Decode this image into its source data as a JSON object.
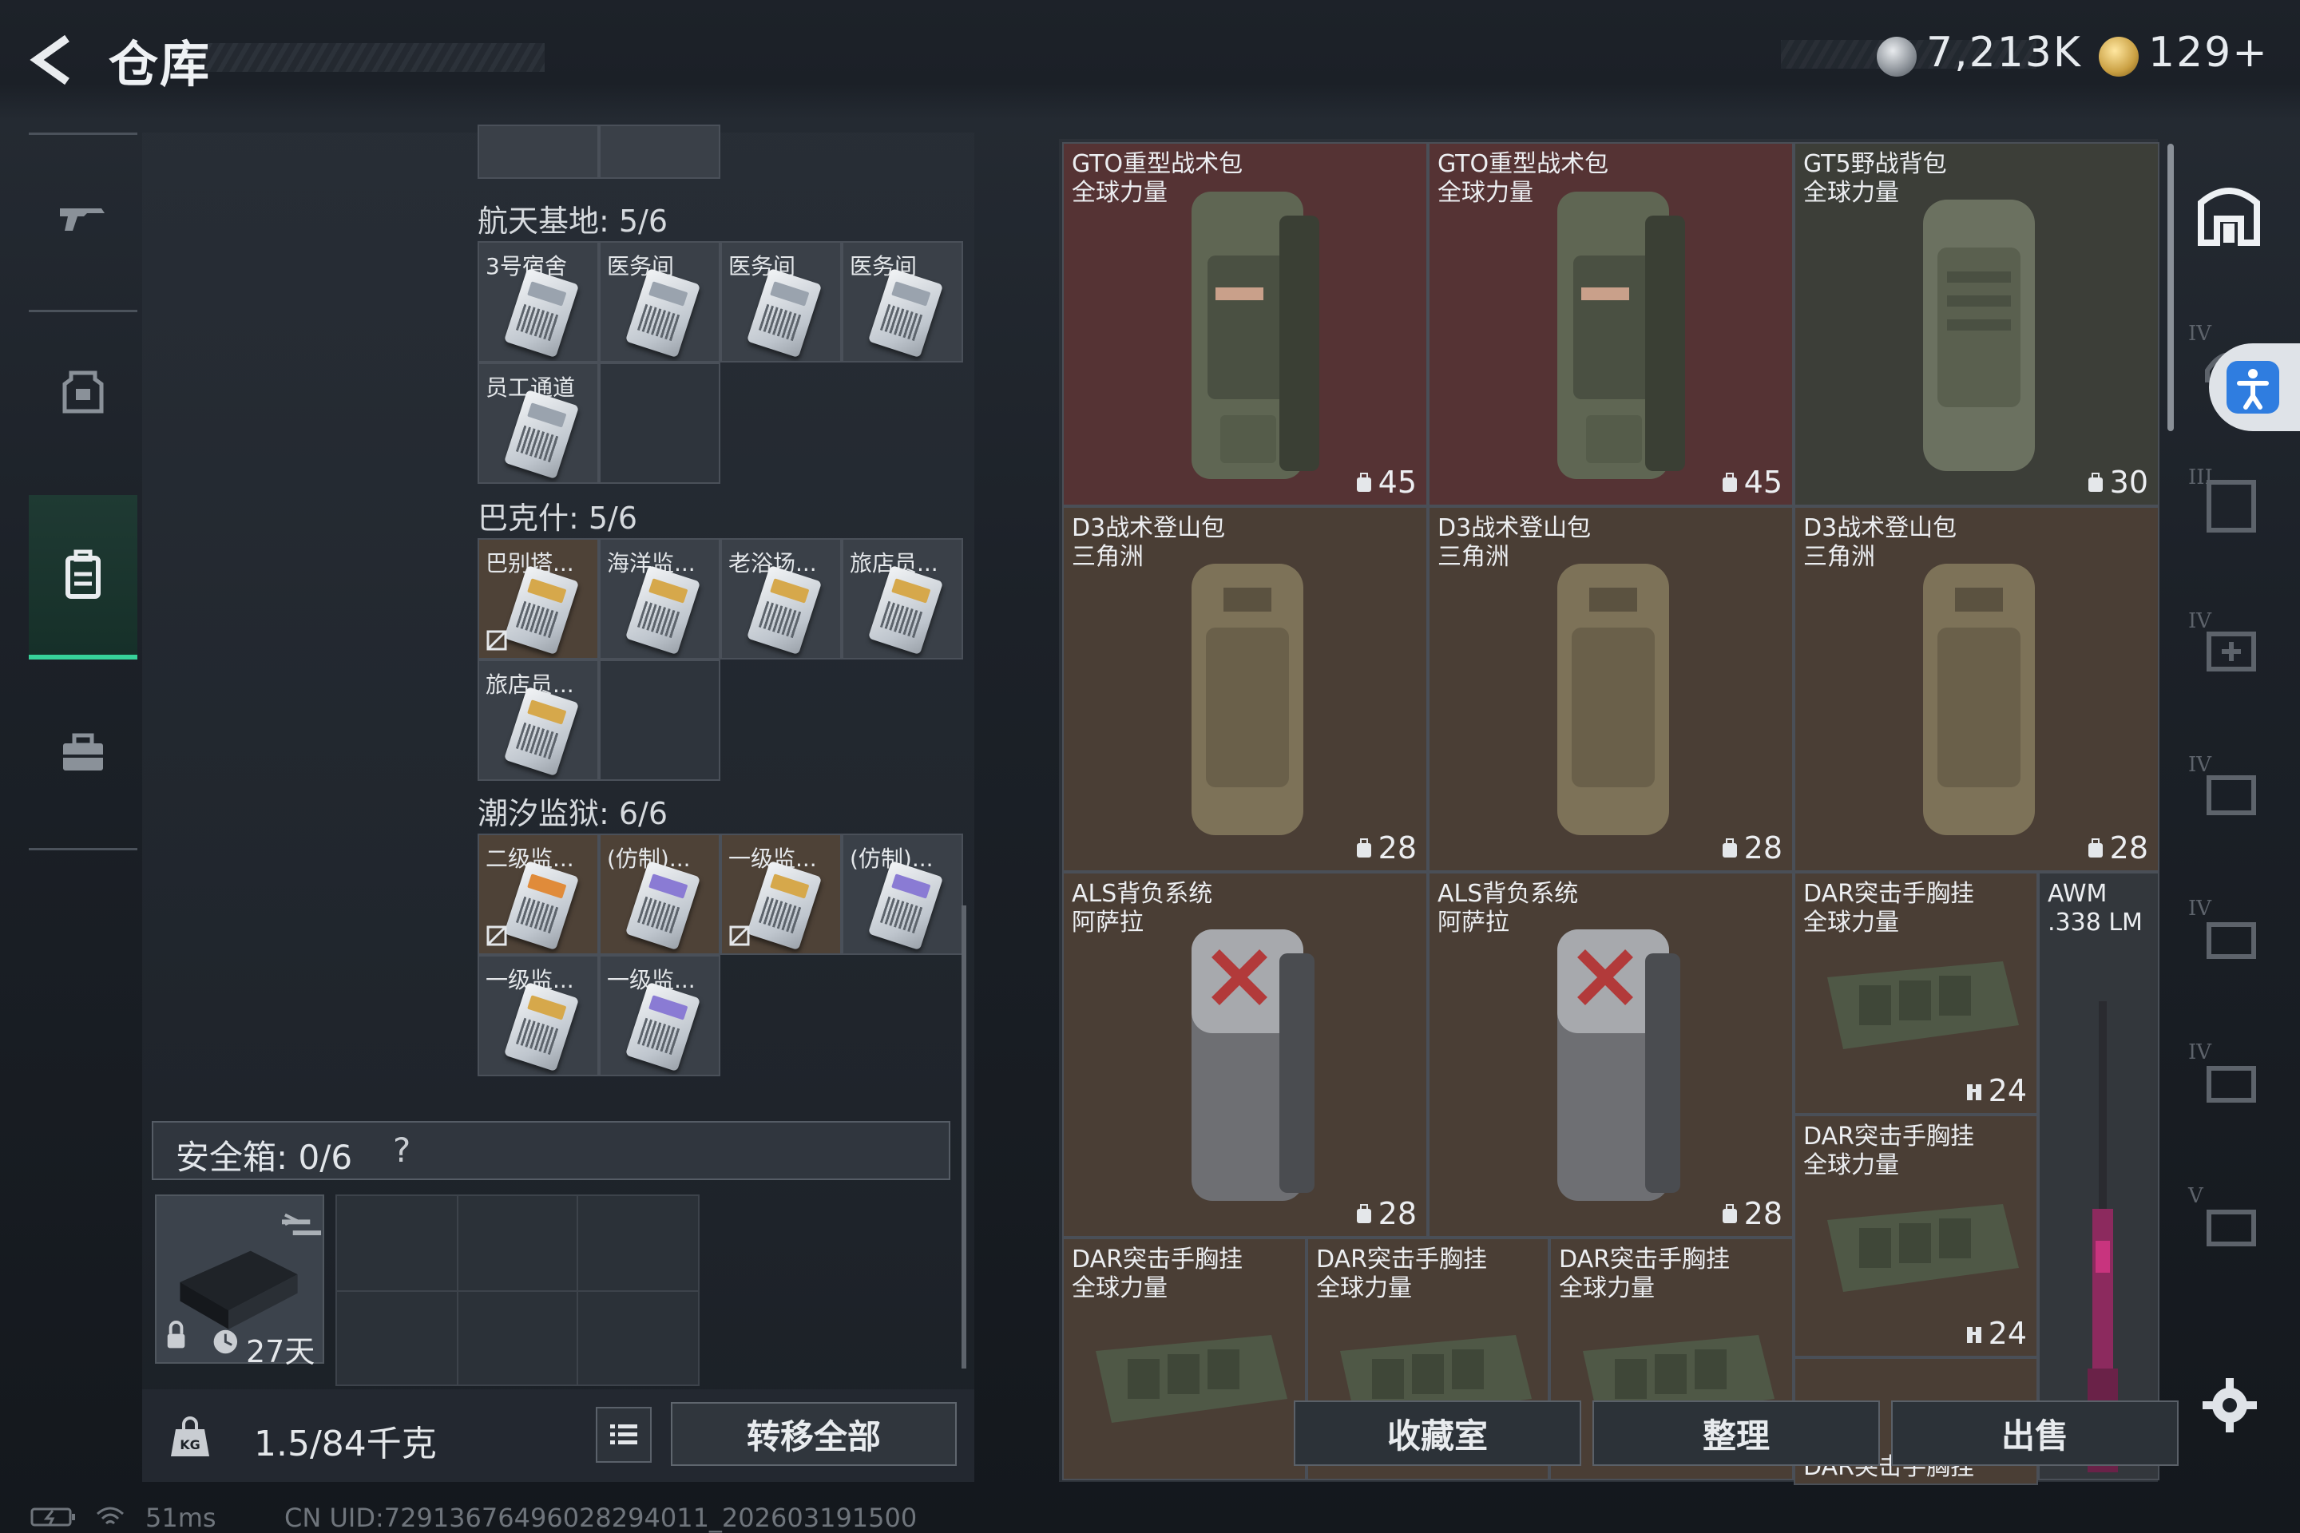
{
  "header": {
    "title": "仓库",
    "silver_value": "7,213K",
    "gold_value": "129+"
  },
  "nav": {
    "items": [
      {
        "name": "weapons",
        "icon": "gun-icon"
      },
      {
        "name": "gear",
        "icon": "armor-icon"
      },
      {
        "name": "backpack",
        "icon": "backpack-icon",
        "active": true
      },
      {
        "name": "items",
        "icon": "toolbox-icon"
      }
    ]
  },
  "keys": {
    "sections": [
      {
        "title": "航天基地: 5/6",
        "slots": [
          "3号宿舍",
          "医务间",
          "医务间",
          "医务间",
          "员工通道",
          ""
        ]
      },
      {
        "title": "巴克什: 5/6",
        "slots": [
          "巴别塔...",
          "海洋监...",
          "老浴场...",
          "旅店员...",
          "旅店员...",
          ""
        ]
      },
      {
        "title": "潮汐监狱: 6/6",
        "slots": [
          "二级监...",
          "(仿制)...",
          "一级监...",
          "(仿制)...",
          "一级监...",
          "一级监..."
        ]
      }
    ]
  },
  "safebox": {
    "label": "安全箱: 0/6",
    "help": "?",
    "duration": "27天"
  },
  "weight": {
    "text": "1.5/84千克"
  },
  "transfer_all": "转移全部",
  "warehouse": {
    "items": [
      {
        "name": "GTO重型战术包\n全球力量",
        "capacity": "45"
      },
      {
        "name": "GTO重型战术包\n全球力量",
        "capacity": "45"
      },
      {
        "name": "GT5野战背包\n全球力量",
        "capacity": "30"
      },
      {
        "name": "D3战术登山包\n三角洲",
        "capacity": "28"
      },
      {
        "name": "D3战术登山包\n三角洲",
        "capacity": "28"
      },
      {
        "name": "D3战术登山包\n三角洲",
        "capacity": "28"
      },
      {
        "name": "ALS背负系统\n阿萨拉",
        "capacity": "28"
      },
      {
        "name": "ALS背负系统\n阿萨拉",
        "capacity": "28"
      },
      {
        "name": "DAR突击手胸挂\n全球力量",
        "capacity": "24"
      },
      {
        "name": "DAR突击手胸挂\n全球力量",
        "capacity": "24"
      },
      {
        "name": "AWM\n.338 LM",
        "capacity": ""
      },
      {
        "name": "DAR突击手胸挂\n全球力量",
        "capacity": ""
      },
      {
        "name": "DAR突击手胸挂\n全球力量",
        "capacity": ""
      },
      {
        "name": "DAR突击手胸挂\n全球力量",
        "capacity": ""
      },
      {
        "name": "DAR突击手胸挂",
        "capacity": ""
      }
    ]
  },
  "actions": {
    "collection": "收藏室",
    "sort": "整理",
    "sell": "出售"
  },
  "status": {
    "ping": "51ms",
    "uid": "CN UID:72913676496028294011_202603191500"
  },
  "colors": {
    "accent": "#37d29a",
    "red_bg": "#553334",
    "brown_bg": "#4a3e35"
  }
}
